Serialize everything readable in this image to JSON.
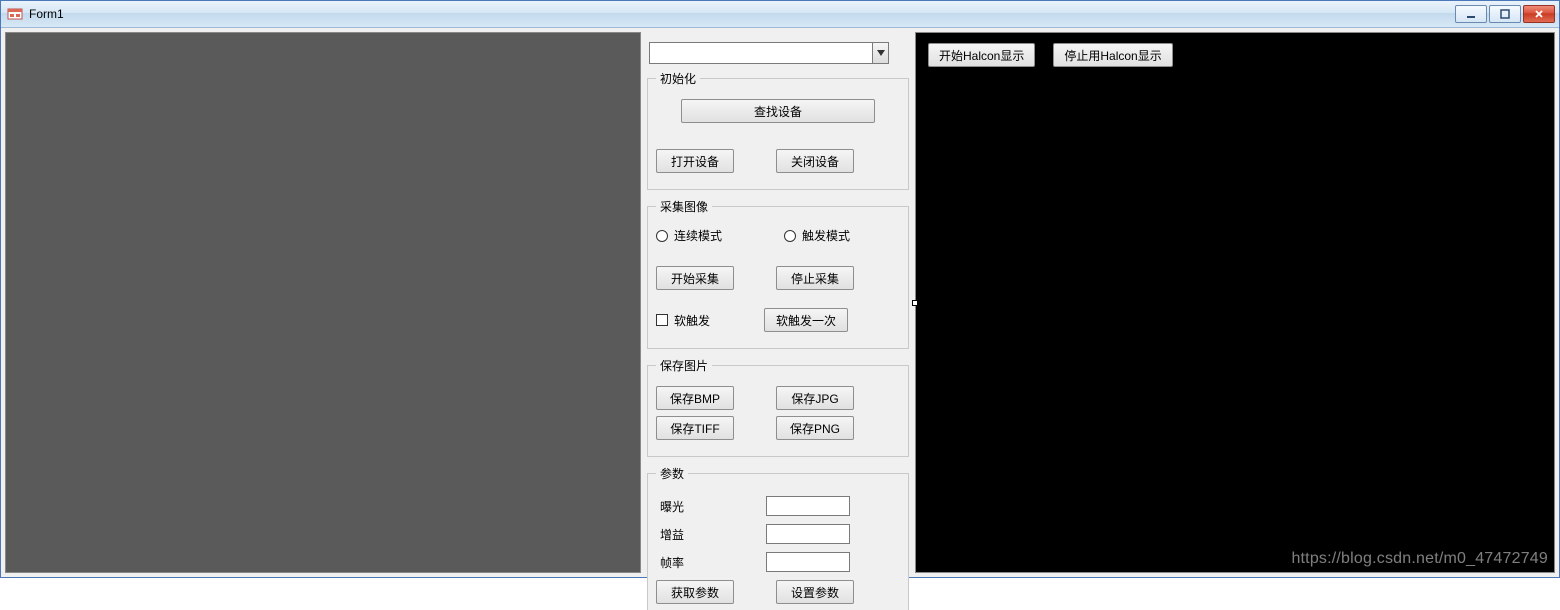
{
  "window": {
    "title": "Form1"
  },
  "combo": {
    "selected": ""
  },
  "groups": {
    "init": {
      "legend": "初始化",
      "find_device": "查找设备",
      "open_device": "打开设备",
      "close_device": "关闭设备"
    },
    "capture": {
      "legend": "采集图像",
      "continuous_mode": "连续模式",
      "trigger_mode": "触发模式",
      "start_capture": "开始采集",
      "stop_capture": "停止采集",
      "soft_trigger": "软触发",
      "soft_trigger_once": "软触发一次"
    },
    "save": {
      "legend": "保存图片",
      "save_bmp": "保存BMP",
      "save_jpg": "保存JPG",
      "save_tiff": "保存TIFF",
      "save_png": "保存PNG"
    },
    "params": {
      "legend": "参数",
      "exposure": "曝光",
      "gain": "增益",
      "frame_rate": "帧率",
      "get_params": "获取参数",
      "set_params": "设置参数",
      "exposure_value": "",
      "gain_value": "",
      "frame_rate_value": ""
    }
  },
  "right_panel": {
    "start_halcon": "开始Halcon显示",
    "stop_halcon": "停止用Halcon显示"
  },
  "watermark": "https://blog.csdn.net/m0_47472749"
}
